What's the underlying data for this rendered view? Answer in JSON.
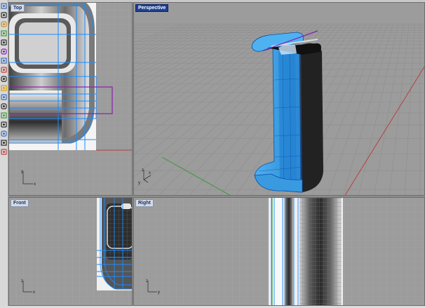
{
  "viewports": {
    "top": {
      "label": "Top"
    },
    "perspective": {
      "label": "Perspective"
    },
    "front": {
      "label": "Front"
    },
    "right": {
      "label": "Right"
    }
  },
  "axes": {
    "x": "x",
    "y": "y",
    "z": "z"
  },
  "toolbar": {
    "tools": [
      "select-tool-icon",
      "point-tool-icon",
      "circle-tool-icon",
      "rectangle-tool-icon",
      "curve-tool-icon",
      "arc-tool-icon",
      "surface-tool-icon",
      "solid-tool-icon",
      "transform-tool-icon",
      "lightning-tool-icon",
      "boolean-tool-icon",
      "join-tool-icon",
      "fillet-tool-icon",
      "offset-tool-icon",
      "array-tool-icon",
      "dimension-tool-icon",
      "render-tool-icon"
    ]
  },
  "colors": {
    "viewport_bg": "#9c9c9c",
    "grid_minor": "#a6a6a6",
    "grid_major": "#8a8a8a",
    "model_blue": "#2a9ee8",
    "model_outline": "#0a4fa8",
    "selection_purple": "#8a1fb0",
    "axis_red": "#b84040",
    "axis_green": "#3a9a3a",
    "active_label_bg": "#1f3f8f"
  }
}
